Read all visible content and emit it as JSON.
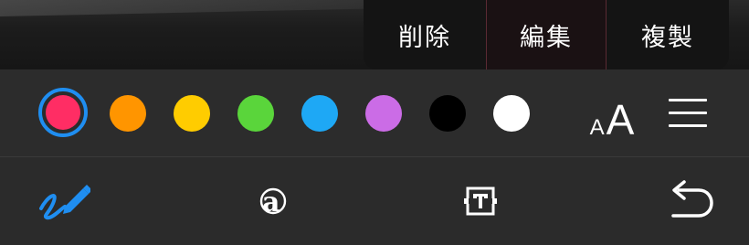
{
  "context_menu": {
    "items": [
      {
        "label": "削除"
      },
      {
        "label": "編集"
      },
      {
        "label": "複製"
      }
    ]
  },
  "color_palette": {
    "selected_index": 0,
    "colors": [
      {
        "name": "pink",
        "hex": "#ff2d64"
      },
      {
        "name": "orange",
        "hex": "#ff9500"
      },
      {
        "name": "yellow",
        "hex": "#ffcc00"
      },
      {
        "name": "green",
        "hex": "#5ad53b"
      },
      {
        "name": "blue",
        "hex": "#1ea8f5"
      },
      {
        "name": "purple",
        "hex": "#cb6ce6"
      },
      {
        "name": "black",
        "hex": "#000000"
      },
      {
        "name": "white",
        "hex": "#ffffff"
      }
    ],
    "selection_ring_color": "#1f8ef1"
  },
  "font_size_button": {
    "small_glyph": "A",
    "large_glyph": "A"
  },
  "toolbar": {
    "icons": [
      "pen-icon",
      "font-style-icon",
      "text-box-icon",
      "undo-icon"
    ],
    "active_color": "#1f8ef1"
  }
}
